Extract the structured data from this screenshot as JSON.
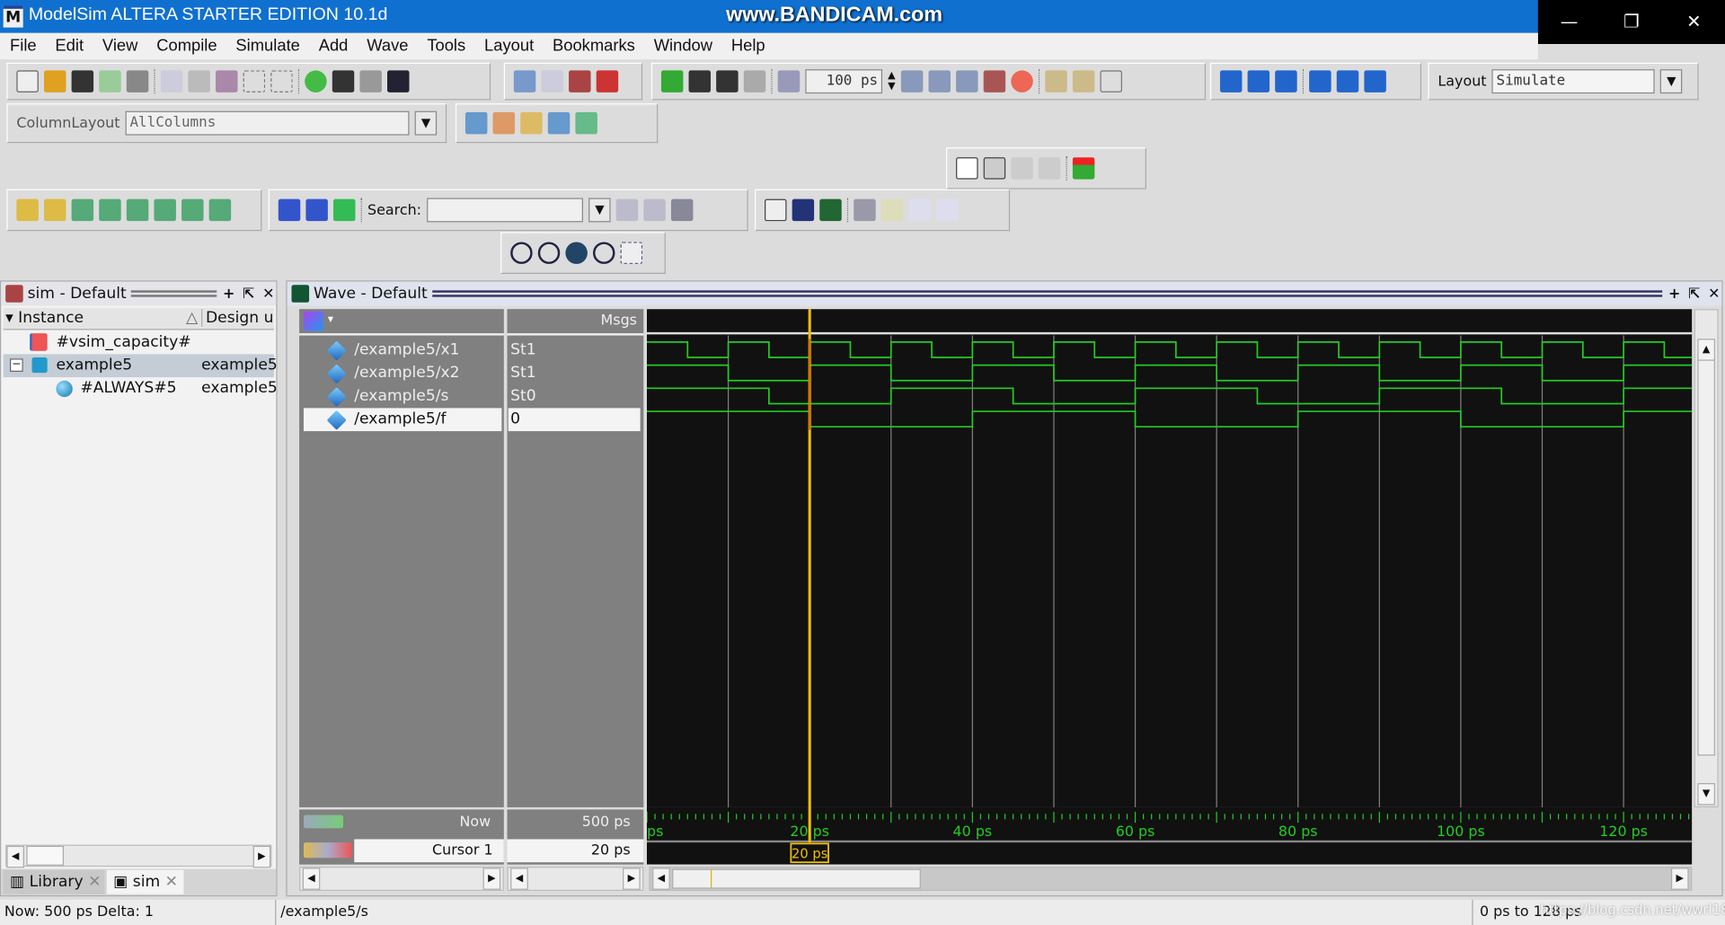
{
  "window": {
    "title": "ModelSim ALTERA STARTER EDITION 10.1d",
    "watermark": "www.BANDICAM.com",
    "logo": "M",
    "controls": [
      "—",
      "❐",
      "✕"
    ]
  },
  "menu": [
    "File",
    "Edit",
    "View",
    "Compile",
    "Simulate",
    "Add",
    "Wave",
    "Tools",
    "Layout",
    "Bookmarks",
    "Window",
    "Help"
  ],
  "toolbar": {
    "run_length": "100 ps",
    "layout_label": "Layout",
    "layout_value": "Simulate",
    "column_layout_label": "ColumnLayout",
    "column_layout_value": "AllColumns",
    "search_label": "Search:",
    "search_value": ""
  },
  "sim_panel": {
    "title": "sim - Default",
    "columns": [
      "Instance",
      "Design unit"
    ],
    "rows": [
      {
        "instance": "#vsim_capacity#",
        "design_unit": ""
      },
      {
        "instance": "example5",
        "design_unit": "example5",
        "expanded": true,
        "selected": true
      },
      {
        "instance": "#ALWAYS#5",
        "design_unit": "example5"
      }
    ],
    "tabs": [
      "Library",
      "sim"
    ]
  },
  "wave_panel": {
    "title": "Wave - Default",
    "msgs_header": "Msgs",
    "now_label": "Now",
    "now_value": "500 ps",
    "cursor_label": "Cursor 1",
    "cursor_value": "20 ps",
    "cursor_flag": "20 ps",
    "signals": [
      {
        "name": "/example5/x1",
        "value": "St1"
      },
      {
        "name": "/example5/x2",
        "value": "St1"
      },
      {
        "name": "/example5/s",
        "value": "St0"
      },
      {
        "name": "/example5/f",
        "value": "0",
        "selected": true
      }
    ],
    "ruler_labels": [
      "ps",
      "20 ps",
      "40 ps",
      "60 ps",
      "80 ps",
      "100 ps",
      "120 ps"
    ],
    "wave_color": "#22cc22",
    "cursor_color": "#f0c000",
    "grid_color": "#808080"
  },
  "chart_data": {
    "type": "line",
    "xlim": [
      0,
      128
    ],
    "xunit": "ps",
    "grid": true,
    "grid_step": 10,
    "cursor": 20,
    "series": [
      {
        "name": "/example5/x1",
        "transitions": [
          [
            0,
            1
          ],
          [
            5,
            0
          ],
          [
            10,
            1
          ],
          [
            15,
            0
          ],
          [
            20,
            1
          ],
          [
            25,
            0
          ],
          [
            30,
            1
          ],
          [
            35,
            0
          ],
          [
            40,
            1
          ],
          [
            45,
            0
          ],
          [
            50,
            1
          ],
          [
            55,
            0
          ],
          [
            60,
            1
          ],
          [
            65,
            0
          ],
          [
            70,
            1
          ],
          [
            75,
            0
          ],
          [
            80,
            1
          ],
          [
            85,
            0
          ],
          [
            90,
            1
          ],
          [
            95,
            0
          ],
          [
            100,
            1
          ],
          [
            105,
            0
          ],
          [
            110,
            1
          ],
          [
            115,
            0
          ],
          [
            120,
            1
          ],
          [
            125,
            0
          ]
        ]
      },
      {
        "name": "/example5/x2",
        "transitions": [
          [
            0,
            1
          ],
          [
            10,
            0
          ],
          [
            20,
            1
          ],
          [
            30,
            0
          ],
          [
            40,
            1
          ],
          [
            50,
            0
          ],
          [
            60,
            1
          ],
          [
            70,
            0
          ],
          [
            80,
            1
          ],
          [
            90,
            0
          ],
          [
            100,
            1
          ],
          [
            110,
            0
          ],
          [
            120,
            1
          ]
        ]
      },
      {
        "name": "/example5/s",
        "transitions": [
          [
            0,
            1
          ],
          [
            15,
            0
          ],
          [
            30,
            1
          ],
          [
            45,
            0
          ],
          [
            60,
            1
          ],
          [
            75,
            0
          ],
          [
            90,
            1
          ],
          [
            105,
            0
          ],
          [
            120,
            1
          ]
        ]
      },
      {
        "name": "/example5/f",
        "transitions": [
          [
            0,
            1
          ],
          [
            20,
            0
          ],
          [
            40,
            1
          ],
          [
            60,
            0
          ],
          [
            80,
            1
          ],
          [
            100,
            0
          ],
          [
            120,
            1
          ]
        ]
      }
    ]
  },
  "status": {
    "now": "Now: 500 ps  Delta: 1",
    "path": "/example5/s",
    "range": "0 ps to 128 ps",
    "watermark": "https://blog.csdn.net/wwrl18"
  }
}
